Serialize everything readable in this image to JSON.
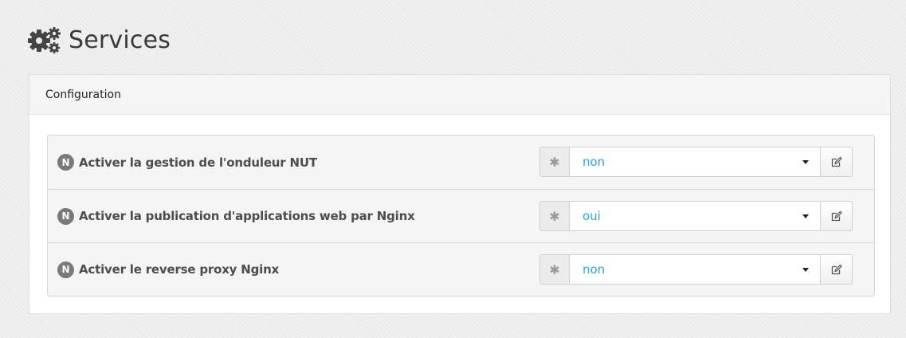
{
  "page": {
    "title": "Services",
    "title_icon": "gears-icon"
  },
  "panel": {
    "heading": "Configuration"
  },
  "rows": [
    {
      "badge": "N",
      "label": "Activer la gestion de l'onduleur NUT",
      "addon": "✱",
      "value": "non",
      "edit_icon": "pencil-square-icon"
    },
    {
      "badge": "N",
      "label": "Activer la publication d'applications web par Nginx",
      "addon": "✱",
      "value": "oui",
      "edit_icon": "pencil-square-icon"
    },
    {
      "badge": "N",
      "label": "Activer le reverse proxy Nginx",
      "addon": "✱",
      "value": "non",
      "edit_icon": "pencil-square-icon"
    }
  ],
  "colors": {
    "value_text": "#2ea8d8",
    "badge_bg": "#7a7a7a"
  }
}
